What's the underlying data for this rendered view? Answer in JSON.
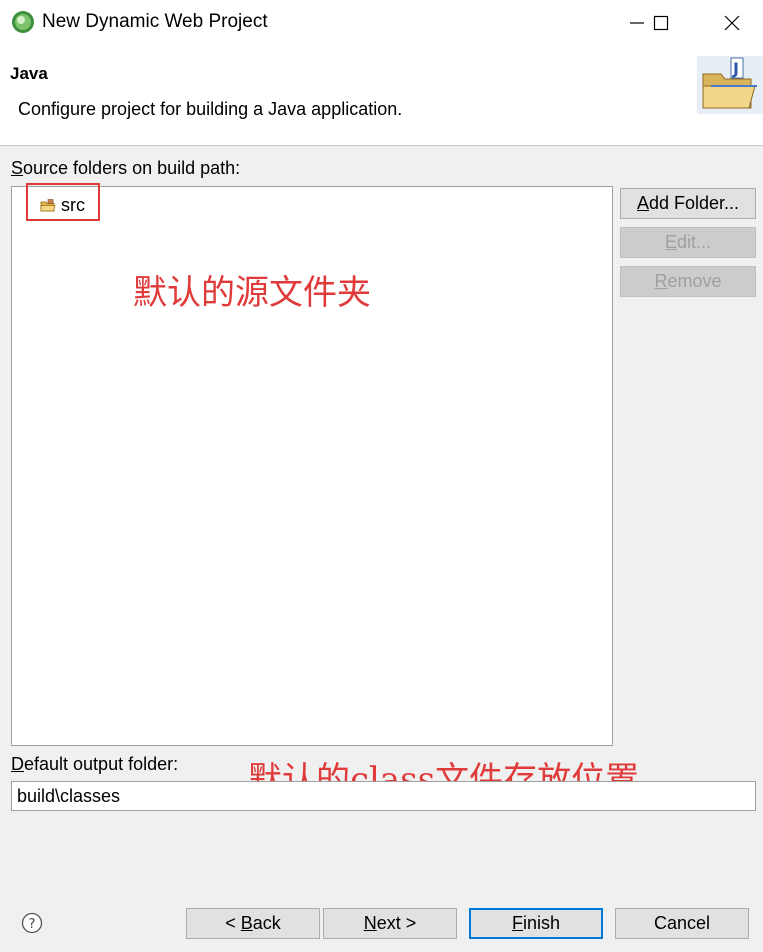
{
  "window": {
    "title": "New Dynamic Web Project",
    "minimize_icon": "minimize-icon",
    "maximize_icon": "maximize-icon",
    "close_icon": "close-icon"
  },
  "header": {
    "title": "Java",
    "description": "Configure project for building a Java application."
  },
  "source_folders": {
    "label_mnemonic": "S",
    "label_rest": "ource folders on build path:",
    "items": [
      {
        "label": "src",
        "icon": "package-folder-icon"
      }
    ]
  },
  "side_buttons": {
    "add_folder_mnemonic": "A",
    "add_folder_rest": "dd Folder...",
    "edit_mnemonic": "E",
    "edit_rest": "dit...",
    "remove_mnemonic": "R",
    "remove_rest": "emove"
  },
  "annotations": {
    "source_note": "默认的源文件夹",
    "output_note": "默认的class文件存放位置"
  },
  "output": {
    "label_mnemonic": "D",
    "label_rest": "efault output folder:",
    "value": "build\\classes"
  },
  "footer": {
    "back_pre": "< ",
    "back_mnemonic": "B",
    "back_rest": "ack",
    "next_mnemonic": "N",
    "next_rest": "ext >",
    "finish_mnemonic": "F",
    "finish_rest": "inish",
    "cancel": "Cancel"
  },
  "colors": {
    "annotation_red": "#e03a3a",
    "default_button_border": "#0078d7"
  }
}
